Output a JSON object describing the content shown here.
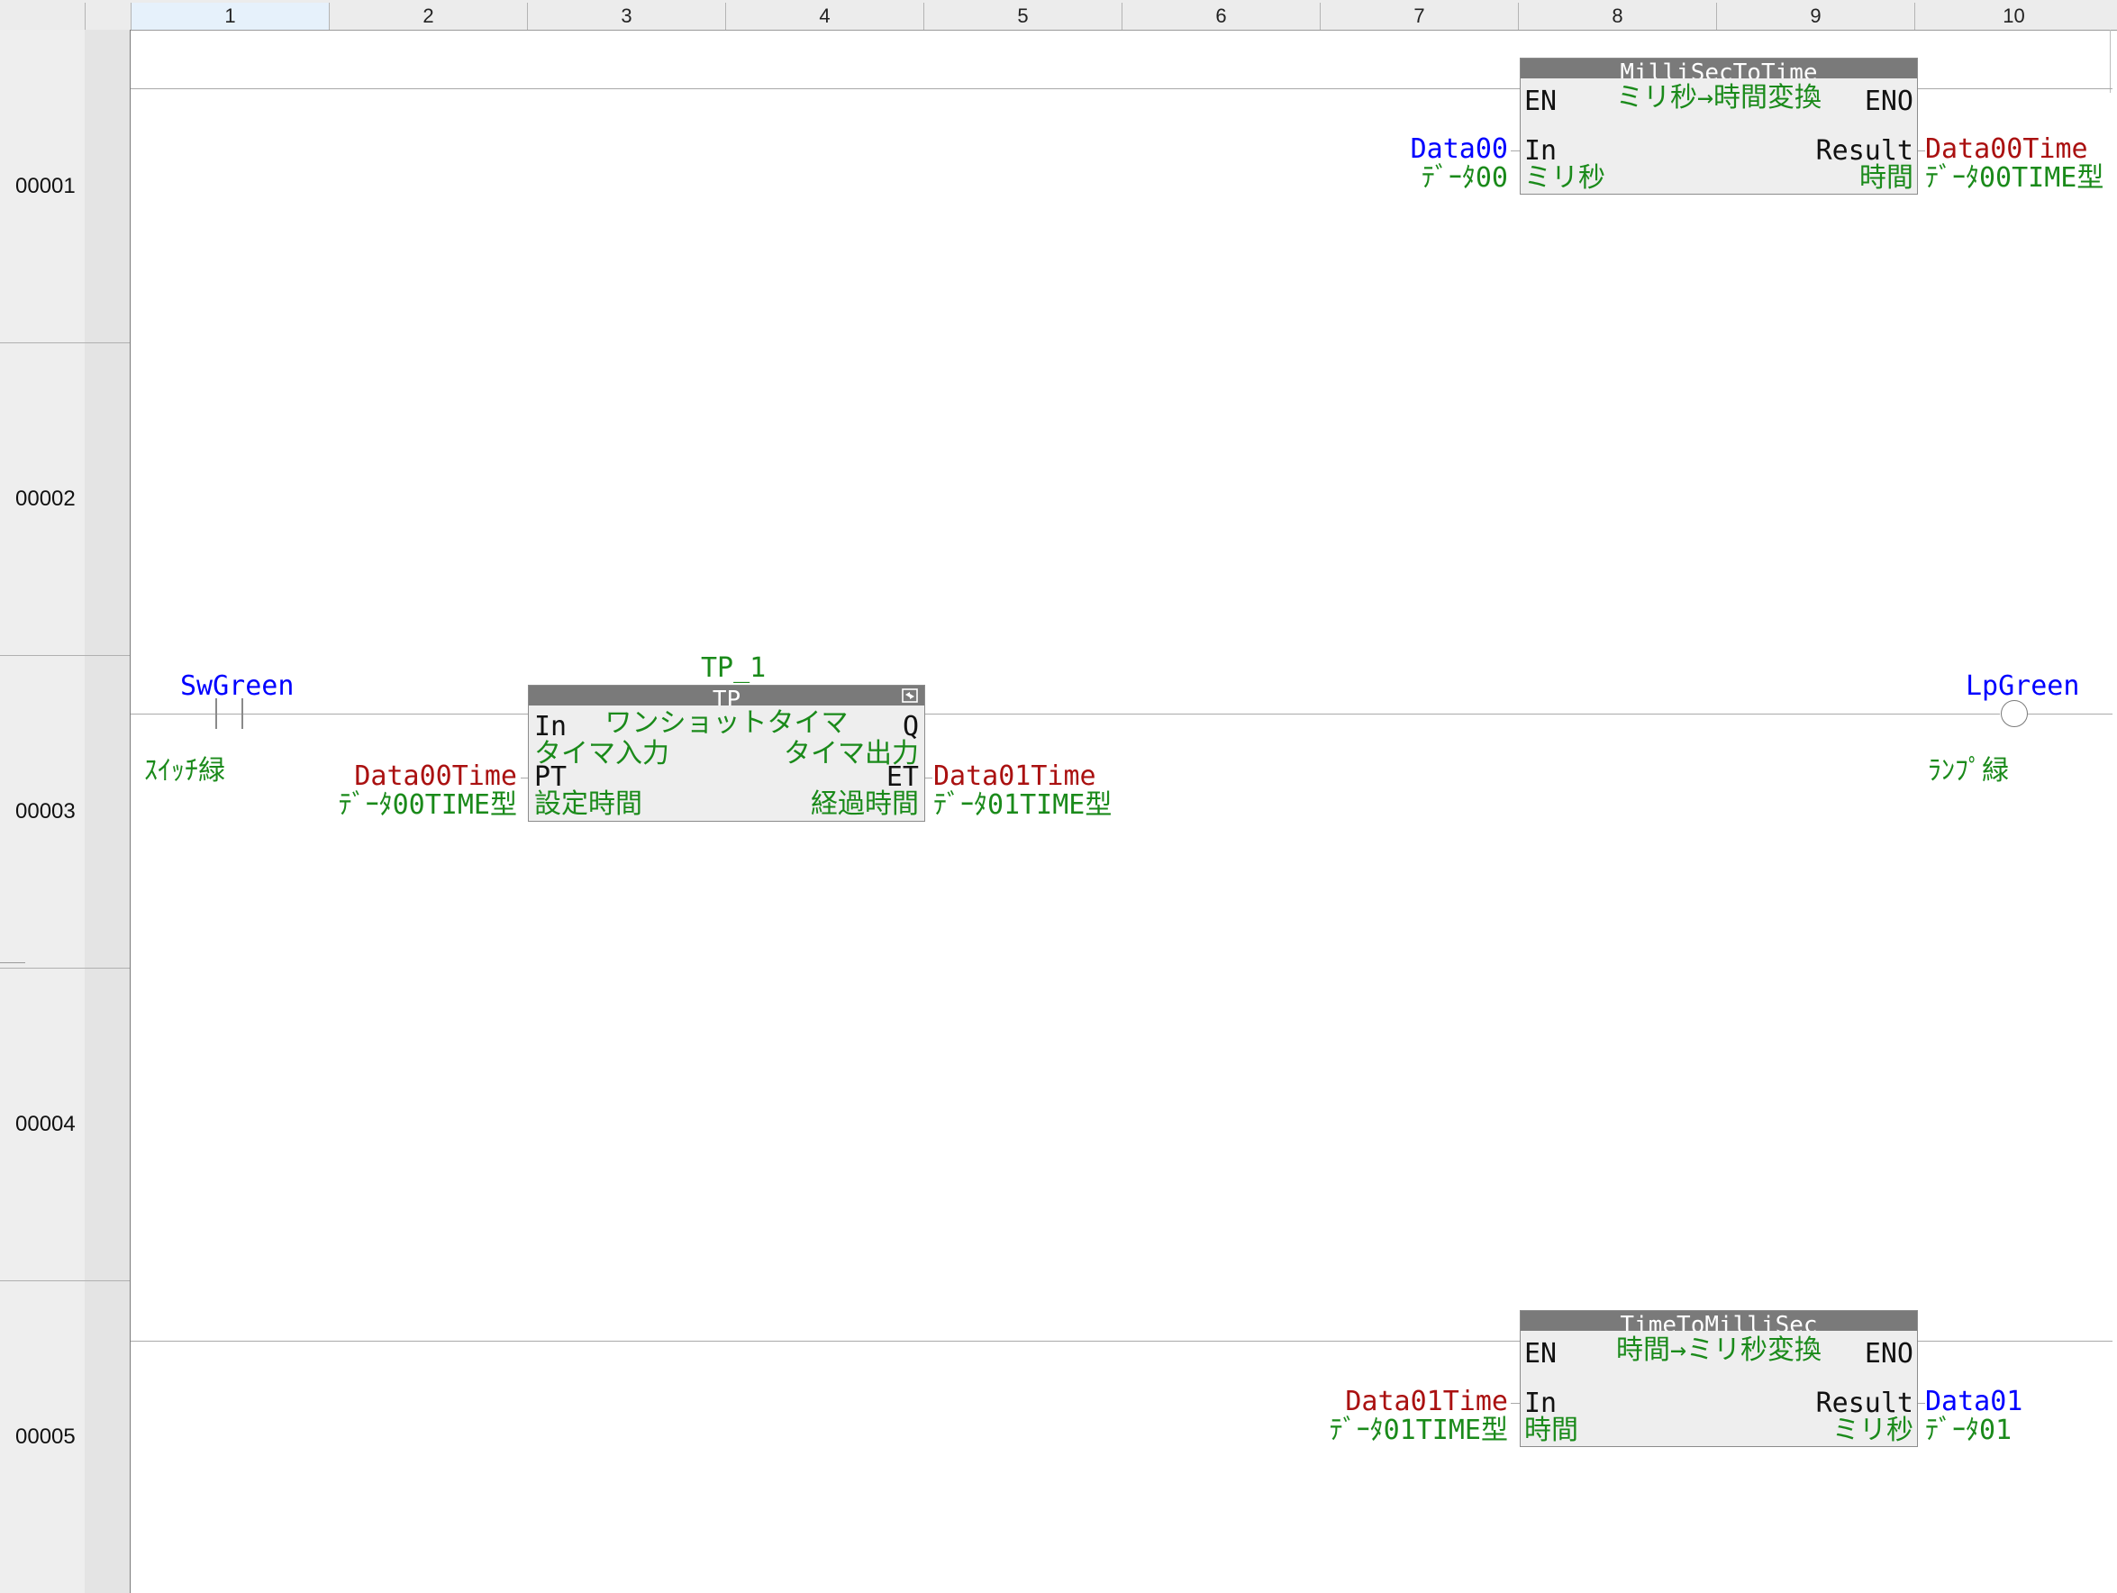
{
  "columns": [
    "1",
    "2",
    "3",
    "4",
    "5",
    "6",
    "7",
    "8",
    "9",
    "10"
  ],
  "rows": [
    "00001",
    "00002",
    "00003",
    "00004",
    "00005"
  ],
  "block_millisec": {
    "type": "MilliSecToTime",
    "comment": "ミリ秒→時間変換",
    "en": "EN",
    "eno": "ENO",
    "in_pin": "In",
    "in_comment": "ミリ秒",
    "out_pin": "Result",
    "out_comment": "時間",
    "in_var": "Data00",
    "in_var_comment": "ﾃﾞｰﾀ00",
    "out_var": "Data00Time",
    "out_var_comment": "ﾃﾞｰﾀ00TIME型"
  },
  "contact": {
    "var": "SwGreen",
    "comment": "ｽｲｯﾁ緑"
  },
  "block_tp": {
    "instance": "TP_1",
    "type": "TP",
    "comment": "ワンショットタイマ",
    "in_pin": "In",
    "in_comment": "タイマ入力",
    "q_pin": "Q",
    "q_comment": "タイマ出力",
    "pt_pin": "PT",
    "pt_comment": "設定時間",
    "et_pin": "ET",
    "et_comment": "経過時間",
    "pt_var": "Data00Time",
    "pt_var_comment": "ﾃﾞｰﾀ00TIME型",
    "et_var": "Data01Time",
    "et_var_comment": "ﾃﾞｰﾀ01TIME型"
  },
  "coil": {
    "var": "LpGreen",
    "comment": "ﾗﾝﾌﾟ緑"
  },
  "block_timetoms": {
    "type": "TimeToMilliSec",
    "comment": "時間→ミリ秒変換",
    "en": "EN",
    "eno": "ENO",
    "in_pin": "In",
    "in_comment": "時間",
    "out_pin": "Result",
    "out_comment": "ミリ秒",
    "in_var": "Data01Time",
    "in_var_comment": "ﾃﾞｰﾀ01TIME型",
    "out_var": "Data01",
    "out_var_comment": "ﾃﾞｰﾀ01"
  },
  "colors": {
    "variable": "#0000ff",
    "time_variable": "#aa1111",
    "comment": "#1a8a1a",
    "block_header": "#7a7a7a",
    "block_body": "#eeeeee"
  }
}
